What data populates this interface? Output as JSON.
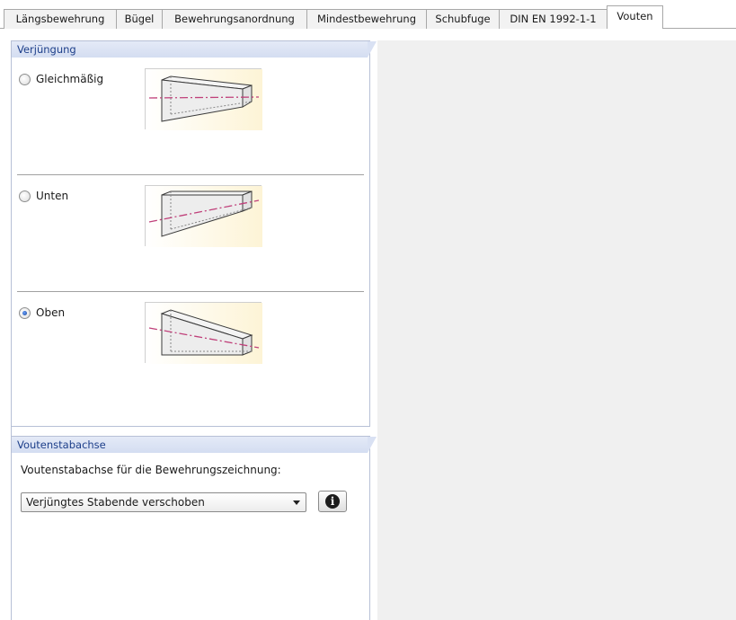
{
  "tabs": [
    {
      "label": "Längsbewehrung",
      "active": false
    },
    {
      "label": "Bügel",
      "active": false
    },
    {
      "label": "Bewehrungsanordnung",
      "active": false
    },
    {
      "label": "Mindestbewehrung",
      "active": false
    },
    {
      "label": "Schubfuge",
      "active": false
    },
    {
      "label": "DIN EN 1992-1-1",
      "active": false
    },
    {
      "label": "Vouten",
      "active": true
    }
  ],
  "verjuengung": {
    "title": "Verjüngung",
    "selected": "Oben",
    "options": [
      {
        "label": "Gleichmäßig",
        "checked": false,
        "image": "haunch-uniform-taper-image"
      },
      {
        "label": "Unten",
        "checked": false,
        "image": "haunch-bottom-taper-image"
      },
      {
        "label": "Oben",
        "checked": true,
        "image": "haunch-top-taper-image"
      }
    ]
  },
  "voutenstabachse": {
    "title": "Voutenstabachse",
    "field_label": "Voutenstabachse für die Bewehrungszeichnung:",
    "selected_value": "Verjüngtes Stabende verschoben",
    "info_icon": "info-icon"
  },
  "colors": {
    "group_title_text": "#1d3f8a",
    "group_title_bg": "#dbe3f5",
    "thumb_bg": "#fdf7e1",
    "axis_line": "#c0407a"
  }
}
